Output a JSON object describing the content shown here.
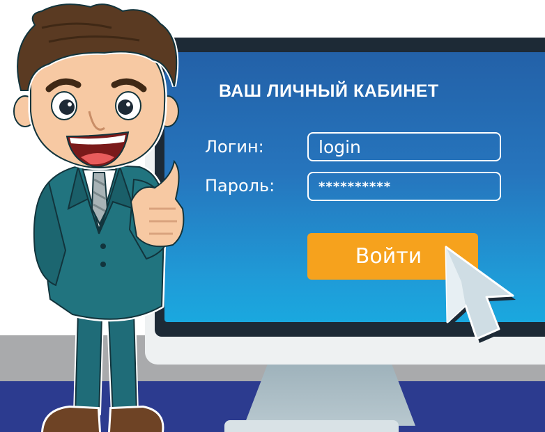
{
  "login_panel": {
    "title": "ВАШ ЛИЧНЫЙ КАБИНЕТ",
    "login_label": "Логин:",
    "login_value": "login",
    "password_label": "Пароль:",
    "password_value": "**********",
    "submit_label": "Войти"
  },
  "colors": {
    "screen_top": "#2361a8",
    "screen_bottom": "#1aa8df",
    "button": "#f6a21d",
    "bezel": "#1d2a36",
    "floor": "#2c3b8f",
    "suit": "#20727e"
  },
  "icons": [
    "mouse-cursor-icon",
    "cartoon-businessman-thumbs-up"
  ]
}
